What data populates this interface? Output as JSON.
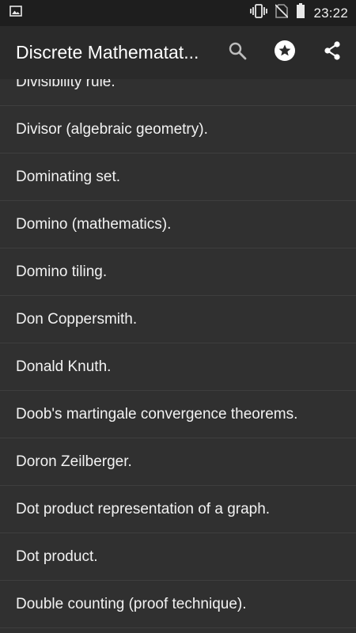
{
  "status_bar": {
    "time": "23:22",
    "icons": [
      "image-notification-icon",
      "vibrate-icon",
      "no-sim-icon",
      "battery-icon"
    ]
  },
  "toolbar": {
    "title": "Discrete Mathematat...",
    "actions": [
      "search-icon",
      "star-icon",
      "share-icon"
    ]
  },
  "list": {
    "items": [
      {
        "label": "Divisibility rule."
      },
      {
        "label": "Divisor (algebraic geometry)."
      },
      {
        "label": "Dominating set."
      },
      {
        "label": "Domino (mathematics)."
      },
      {
        "label": "Domino tiling."
      },
      {
        "label": "Don Coppersmith."
      },
      {
        "label": "Donald Knuth."
      },
      {
        "label": "Doob's martingale convergence theorems."
      },
      {
        "label": "Doron Zeilberger."
      },
      {
        "label": "Dot product representation of a graph."
      },
      {
        "label": "Dot product."
      },
      {
        "label": "Double counting (proof technique)."
      }
    ]
  },
  "colors": {
    "status_bar_bg": "#1e1e1e",
    "toolbar_bg": "#2a2a2a",
    "list_bg": "#303030",
    "divider": "#3e3e3e",
    "text": "#f2f2f2"
  }
}
